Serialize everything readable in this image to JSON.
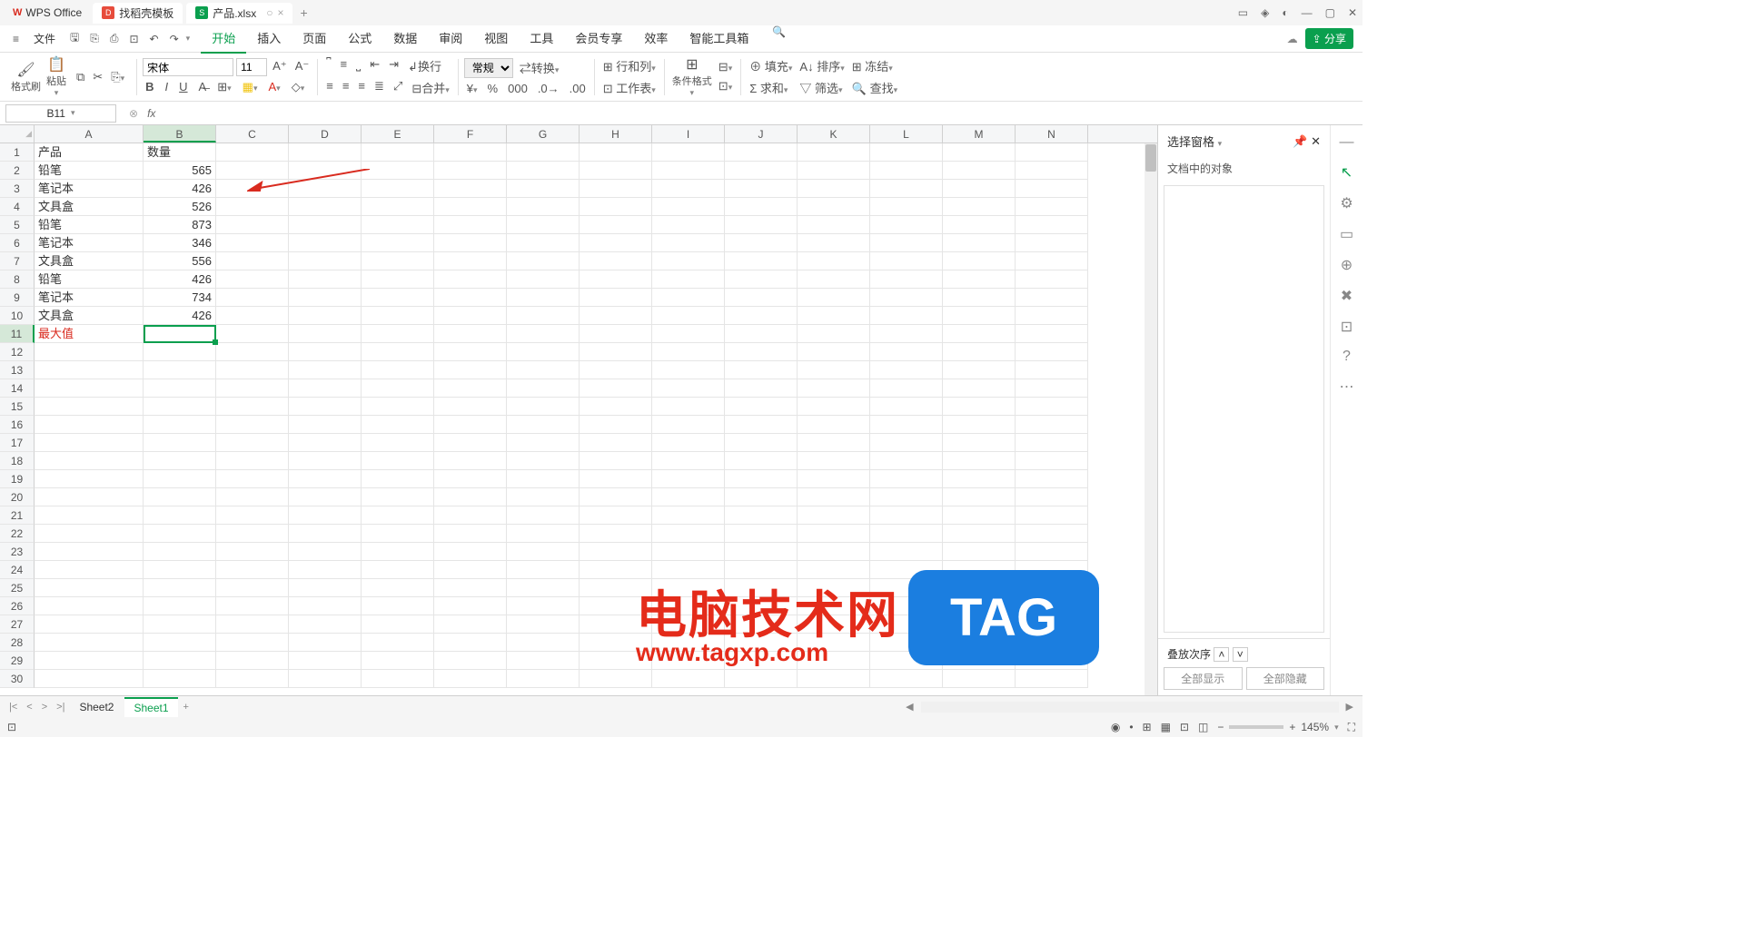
{
  "titlebar": {
    "app_name": "WPS Office",
    "tab_template": "找稻壳模板",
    "tab_file": "产品.xlsx"
  },
  "menu": {
    "hamburger": "≡",
    "file": "文件",
    "tabs": [
      "开始",
      "插入",
      "页面",
      "公式",
      "数据",
      "审阅",
      "视图",
      "工具",
      "会员专享",
      "效率",
      "智能工具箱"
    ],
    "share": "分享"
  },
  "ribbon": {
    "format_painter": "格式刷",
    "paste": "粘贴",
    "font": "宋体",
    "font_size": "11",
    "number_format": "常规",
    "convert": "转换",
    "rowcol": "行和列",
    "worksheet": "工作表",
    "cond_fmt": "条件格式",
    "fill": "填充",
    "sort": "排序",
    "freeze": "冻结",
    "sum": "求和",
    "filter": "筛选",
    "find": "查找",
    "wrap": "换行",
    "merge": "合并"
  },
  "formula": {
    "name_box": "B11",
    "fx": "fx"
  },
  "columns": [
    "A",
    "B",
    "C",
    "D",
    "E",
    "F",
    "G",
    "H",
    "I",
    "J",
    "K",
    "L",
    "M",
    "N"
  ],
  "data": {
    "header": [
      "产品",
      "数量"
    ],
    "rows": [
      [
        "铅笔",
        "565"
      ],
      [
        "笔记本",
        "426"
      ],
      [
        "文具盒",
        "526"
      ],
      [
        "铅笔",
        "873"
      ],
      [
        "笔记本",
        "346"
      ],
      [
        "文具盒",
        "556"
      ],
      [
        "铅笔",
        "426"
      ],
      [
        "笔记本",
        "734"
      ],
      [
        "文具盒",
        "426"
      ]
    ],
    "max_label": "最大值"
  },
  "right_panel": {
    "title": "选择窗格",
    "subtitle": "文档中的对象",
    "order": "叠放次序",
    "show_all": "全部显示",
    "hide_all": "全部隐藏"
  },
  "sheets": {
    "s2": "Sheet2",
    "s1": "Sheet1"
  },
  "status": {
    "zoom": "145%"
  },
  "watermark": {
    "text": "电脑技术网",
    "url": "www.tagxp.com",
    "tag": "TAG"
  },
  "chart_data": {
    "type": "table",
    "categories": [
      "铅笔",
      "笔记本",
      "文具盒",
      "铅笔",
      "笔记本",
      "文具盒",
      "铅笔",
      "笔记本",
      "文具盒"
    ],
    "values": [
      565,
      426,
      526,
      873,
      346,
      556,
      426,
      734,
      426
    ],
    "title": "产品 数量",
    "xlabel": "产品",
    "ylabel": "数量"
  }
}
